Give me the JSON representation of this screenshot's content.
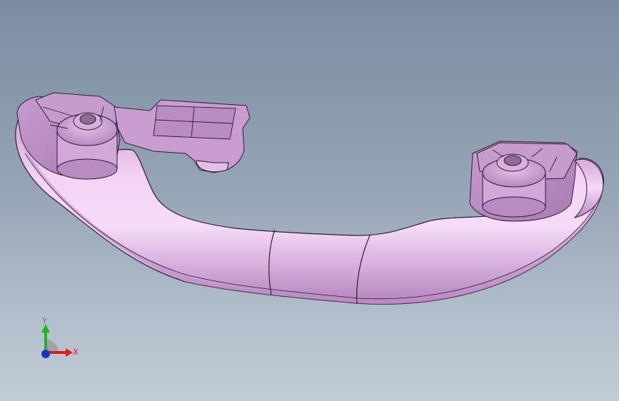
{
  "viewport": {
    "background_top": "#7c8da2",
    "background_bottom": "#c2ccd7"
  },
  "model": {
    "part": "grab-handle",
    "body_color": "#e3b7e8",
    "edge_color": "#2a1f2c"
  },
  "triad": {
    "x_label": "X",
    "y_label": "Y",
    "x_color": "#e01b1b",
    "y_color": "#25b325",
    "z_color": "#1f2fd0"
  }
}
